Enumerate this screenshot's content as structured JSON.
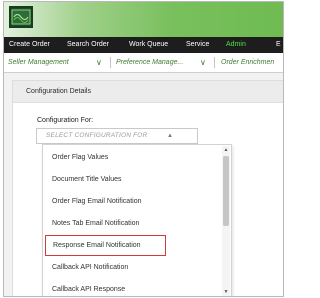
{
  "nav": {
    "items": [
      {
        "label": "Create Order"
      },
      {
        "label": "Search Order"
      },
      {
        "label": "Work Queue"
      },
      {
        "label": "Service"
      },
      {
        "label": "Admin",
        "active": true
      },
      {
        "label": "E"
      }
    ]
  },
  "subnav": {
    "items": [
      {
        "label": "Seller Management"
      },
      {
        "label": "Preference Manage..."
      },
      {
        "label": "Order Enrichmen"
      }
    ]
  },
  "section": {
    "title": "Configuration Details"
  },
  "form": {
    "label": "Configuration For:",
    "placeholder": "SELECT CONFIGURATION FOR"
  },
  "dropdown": {
    "options": [
      {
        "label": "Order Flag Values"
      },
      {
        "label": "Document Title Values"
      },
      {
        "label": "Order Flag Email Notification"
      },
      {
        "label": "Notes Tab Email Notification"
      },
      {
        "label": "Response Email Notification",
        "highlighted": true
      },
      {
        "label": "Callback API Notification"
      },
      {
        "label": "Callback API Response"
      }
    ]
  },
  "colors": {
    "navbar_bg": "#1d1d1d",
    "active_nav": "#4fe246",
    "subnav_text": "#3e7d2e",
    "highlight_border": "#d33b3b"
  },
  "icons": {
    "logo": "app-logo-icon",
    "subnav_caret": "chevron-down-icon",
    "select_caret": "caret-up-icon",
    "scroll_up": "scroll-up-arrow-icon",
    "scroll_down": "scroll-down-arrow-icon"
  }
}
